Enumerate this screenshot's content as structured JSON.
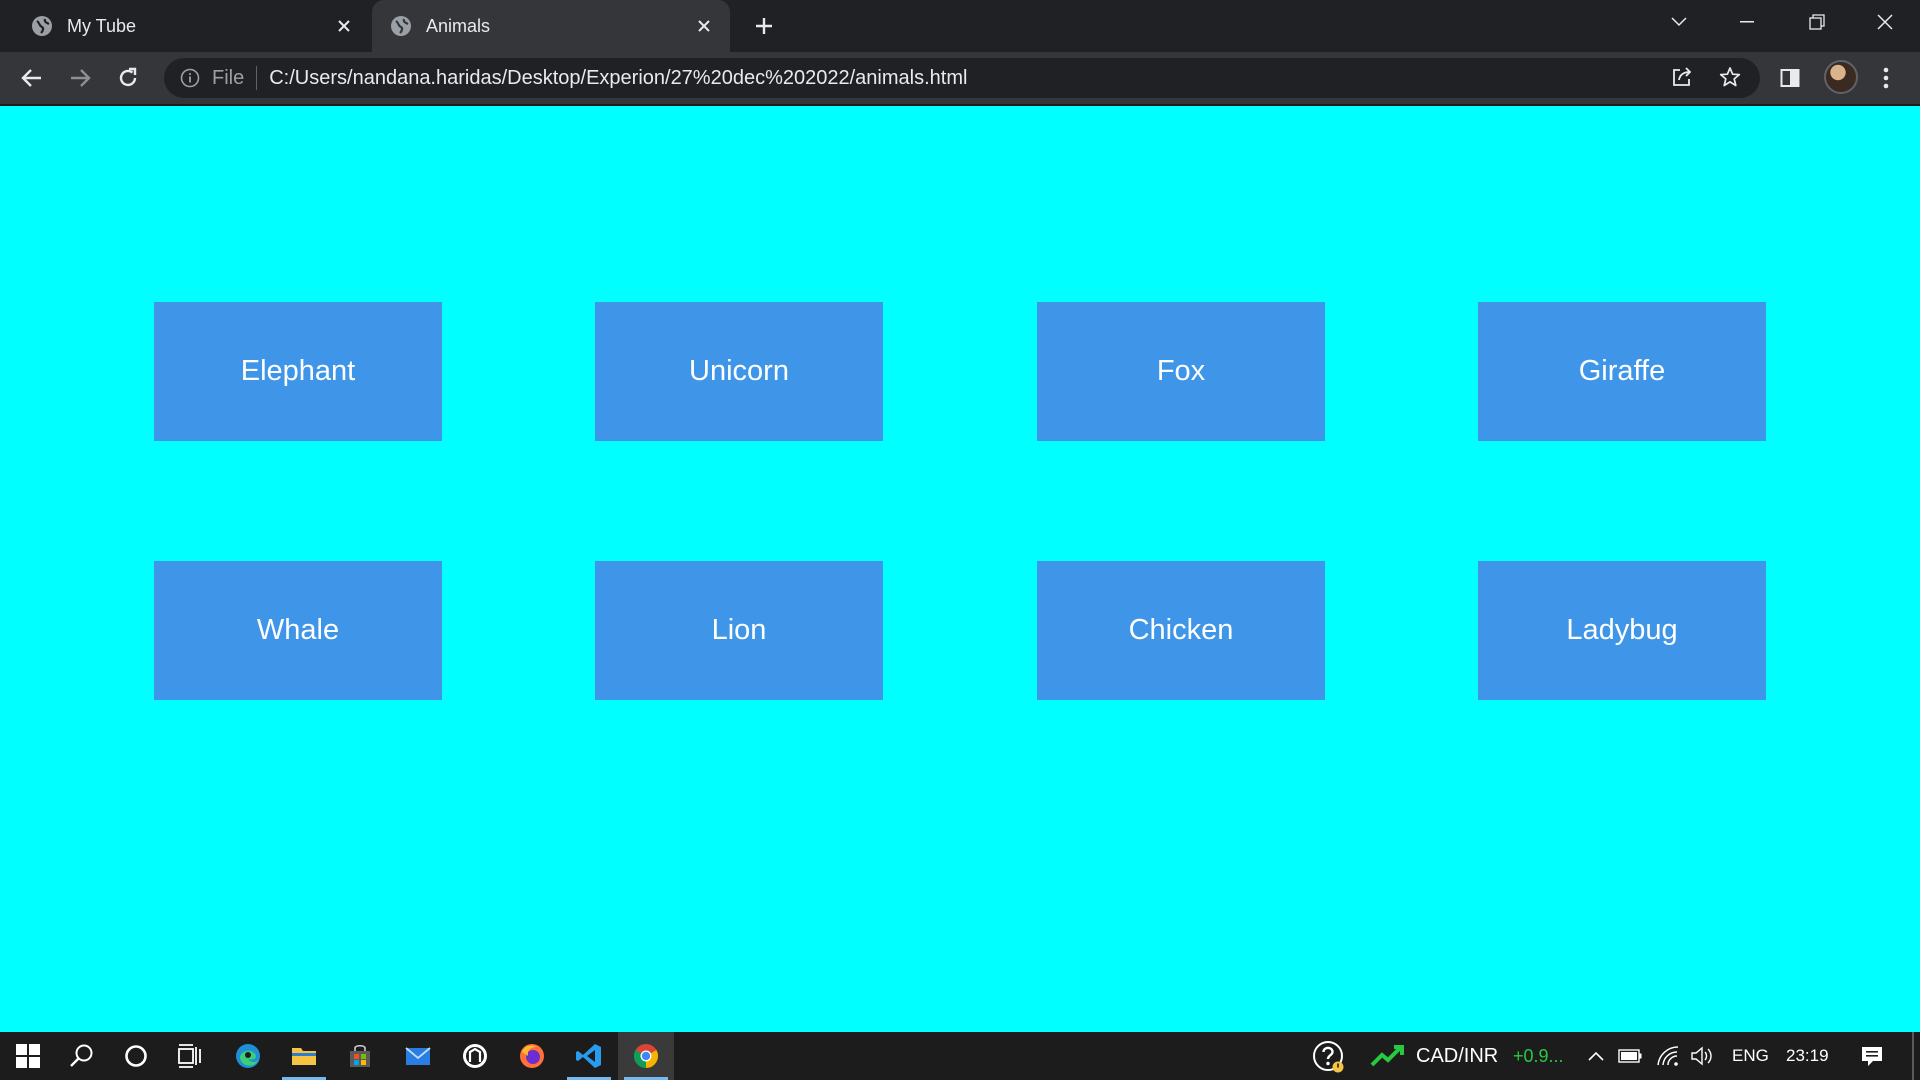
{
  "browser": {
    "tabs": [
      {
        "title": "My Tube",
        "active": false
      },
      {
        "title": "Animals",
        "active": true
      }
    ],
    "address": {
      "scheme_label": "File",
      "url": "C:/Users/nandana.haridas/Desktop/Experion/27%20dec%202022/animals.html"
    }
  },
  "page": {
    "background_color": "#00ffff",
    "box_color": "#3f96e9",
    "animals": [
      "Elephant",
      "Unicorn",
      "Fox",
      "Giraffe",
      "Whale",
      "Lion",
      "Chicken",
      "Ladybug"
    ]
  },
  "taskbar": {
    "ticker_label": "CAD/INR",
    "ticker_change": "+0.9...",
    "ticker_change_color": "#27c93f",
    "language": "ENG",
    "time": "23:19"
  }
}
